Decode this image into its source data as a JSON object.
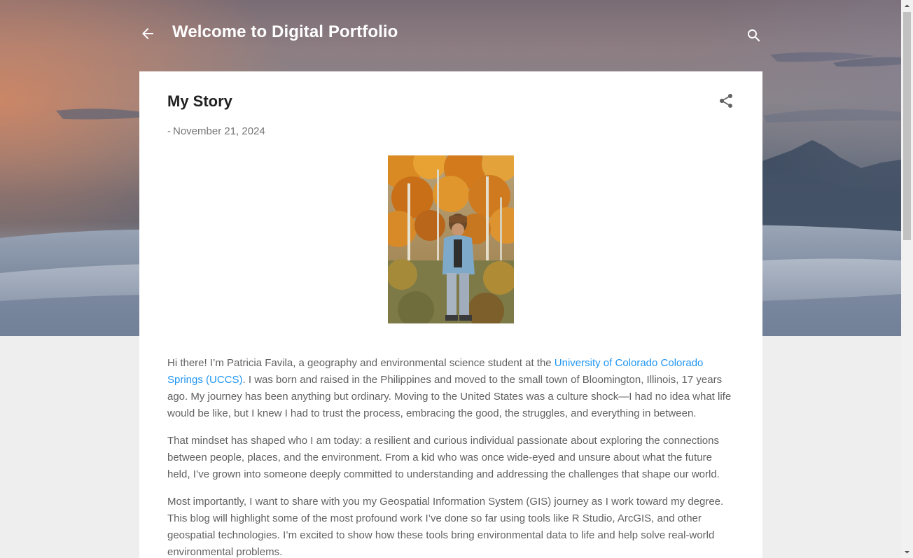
{
  "header": {
    "title": "Welcome to Digital Portfolio",
    "back_icon": "arrow-left-icon",
    "search_icon": "search-icon"
  },
  "post": {
    "title": "My Story",
    "date_prefix": "-",
    "date": "November 21, 2024",
    "share_icon": "share-icon",
    "image_alt": "Photo of a person standing among autumn aspen trees",
    "paragraphs": {
      "p1_before_link": "Hi there! I’m Patricia Favila, a geography and environmental science student at the ",
      "p1_link": "University of Colorado Colorado Springs (UCCS)",
      "p1_after_link": ". I was born and raised in the Philippines and moved to the small town of Bloomington, Illinois, 17 years ago. My journey has been anything but ordinary. Moving to the United States was a culture shock—I had no idea what life would be like, but I knew I had to trust the process, embracing the good, the struggles, and everything in between.",
      "p2": "That mindset has shaped who I am today: a resilient and curious individual passionate about exploring the connections between people, places, and the environment. From a kid who was once wide-eyed and unsure about what the future held, I’ve grown into someone deeply committed to understanding and addressing the challenges that shape our world.",
      "p3": "Most importantly, I want to share with you my Geospatial Information System (GIS) journey as I work toward my degree. This blog will highlight some of the most profound work I’ve done so far using tools like R Studio, ArcGIS, and other geospatial technologies. I’m excited to show how these tools bring environmental data to life and help solve real-world environmental problems."
    }
  },
  "colors": {
    "link": "#2196f3",
    "title_text": "#212121",
    "body_text": "#616161",
    "page_bg": "#eeeeee"
  }
}
